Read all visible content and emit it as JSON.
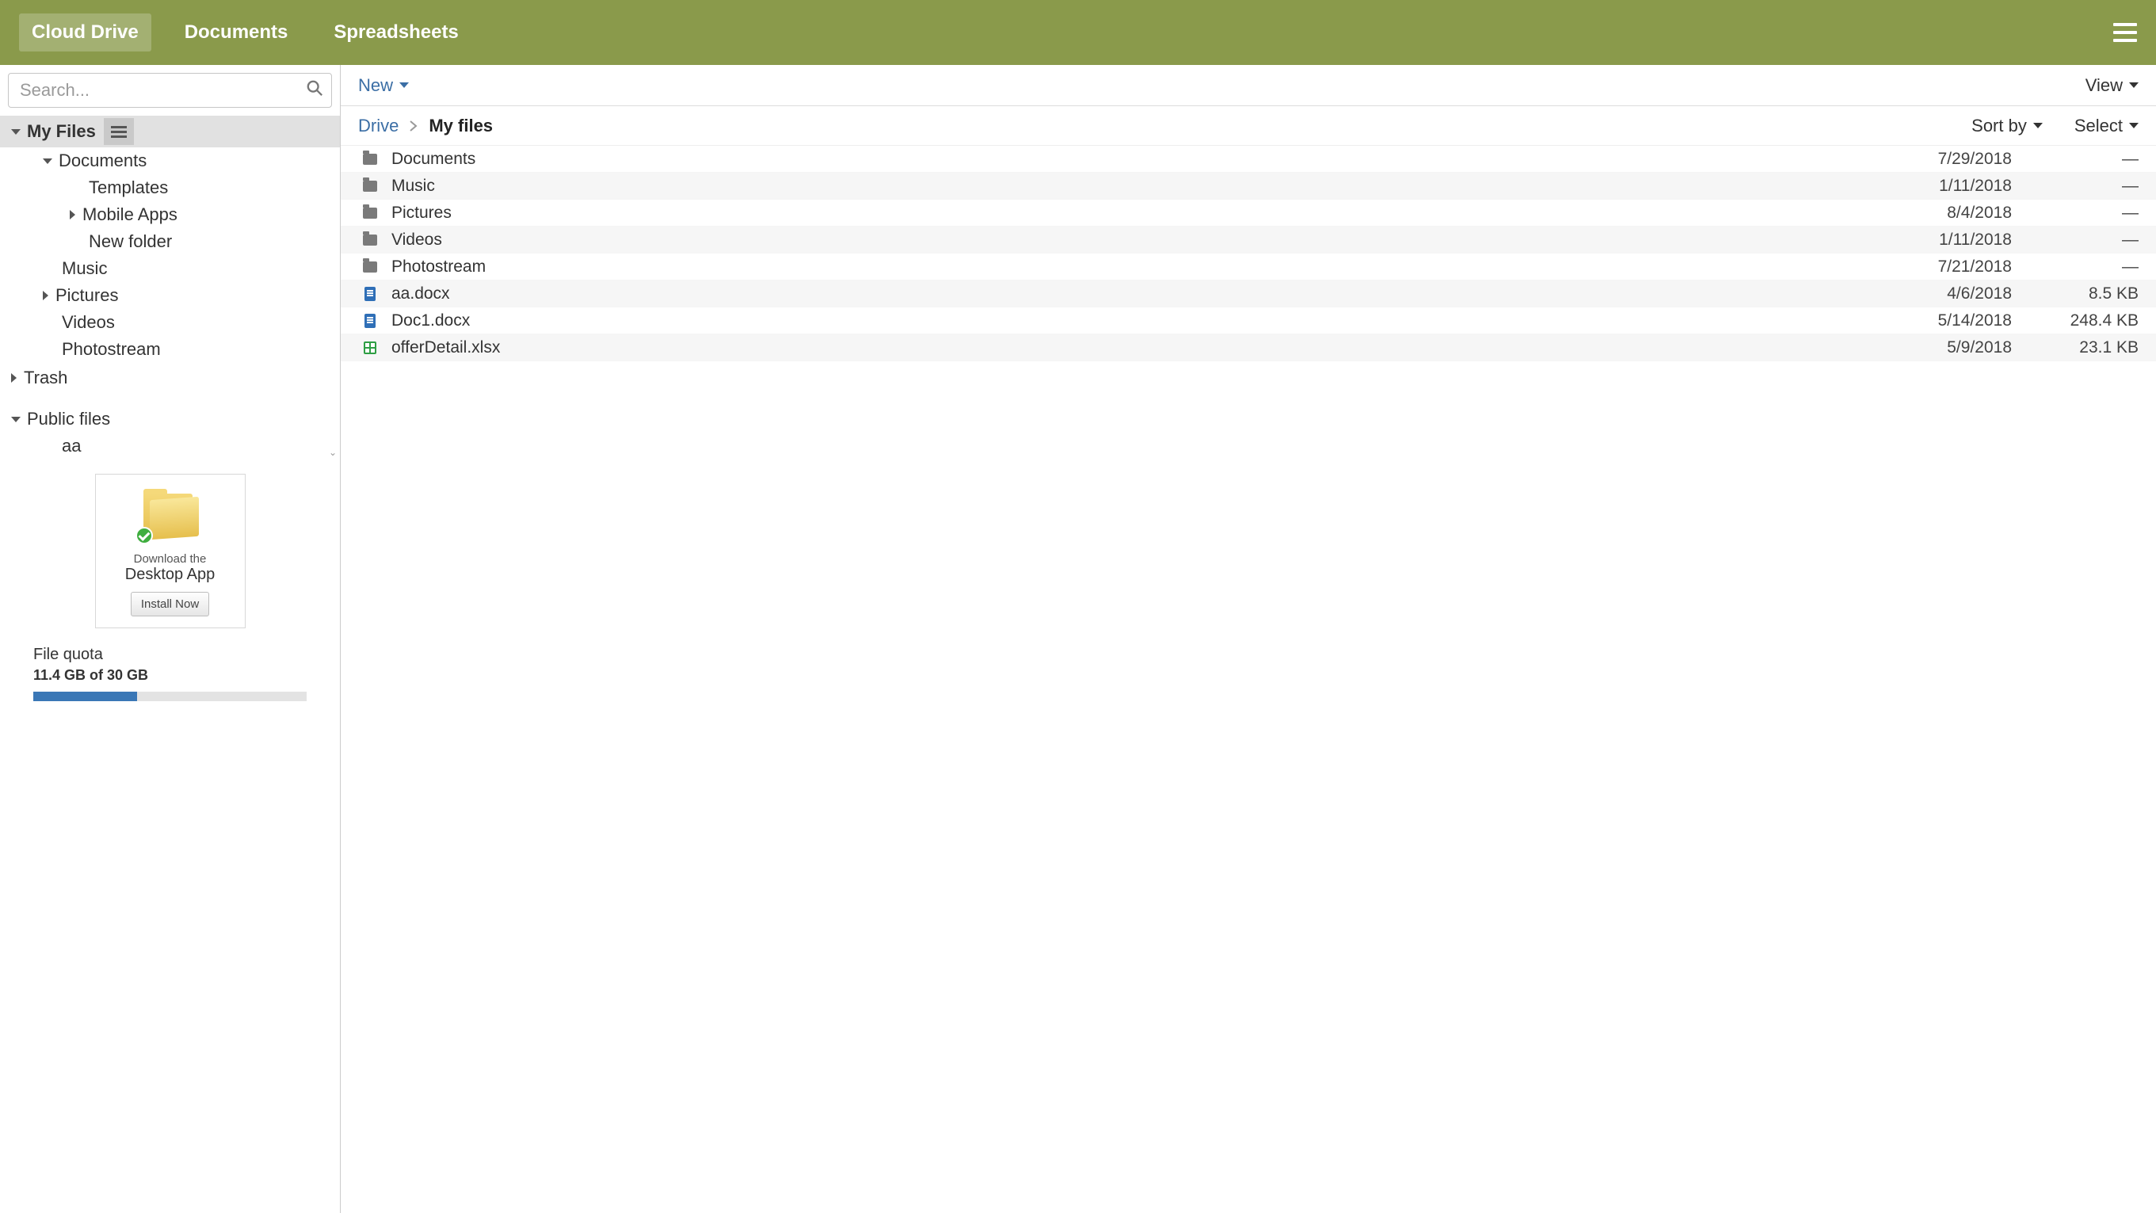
{
  "topbar": {
    "tabs": [
      {
        "label": "Cloud Drive",
        "active": true
      },
      {
        "label": "Documents",
        "active": false
      },
      {
        "label": "Spreadsheets",
        "active": false
      }
    ]
  },
  "search": {
    "placeholder": "Search..."
  },
  "tree": {
    "root": "My Files",
    "nodes": [
      {
        "label": "Documents",
        "level": 1,
        "caret": "down",
        "id": "documents"
      },
      {
        "label": "Templates",
        "level": 2,
        "caret": "none",
        "id": "templates"
      },
      {
        "label": "Mobile Apps",
        "level": 2,
        "caret": "right",
        "id": "mobile-apps"
      },
      {
        "label": "New folder",
        "level": 2,
        "caret": "none",
        "id": "new-folder"
      },
      {
        "label": "Music",
        "level": 1,
        "caret": "none",
        "id": "music"
      },
      {
        "label": "Pictures",
        "level": 1,
        "caret": "right",
        "id": "pictures"
      },
      {
        "label": "Videos",
        "level": 1,
        "caret": "none",
        "id": "videos"
      },
      {
        "label": "Photostream",
        "level": 1,
        "caret": "none",
        "id": "photostream"
      }
    ],
    "trash": "Trash",
    "public": "Public files",
    "public_children": [
      {
        "label": "aa",
        "id": "public-aa"
      }
    ]
  },
  "promo": {
    "line1": "Download the",
    "line2": "Desktop App",
    "button": "Install Now"
  },
  "quota": {
    "label": "File quota",
    "text": "11.4 GB of 30 GB",
    "percent": 38
  },
  "toolbar": {
    "new_label": "New",
    "view_label": "View"
  },
  "listbar": {
    "drive": "Drive",
    "current": "My files",
    "sort": "Sort by",
    "select": "Select"
  },
  "files": [
    {
      "type": "folder",
      "name": "Documents",
      "date": "7/29/2018",
      "size": "—"
    },
    {
      "type": "folder",
      "name": "Music",
      "date": "1/11/2018",
      "size": "—"
    },
    {
      "type": "folder",
      "name": "Pictures",
      "date": "8/4/2018",
      "size": "—"
    },
    {
      "type": "folder",
      "name": "Videos",
      "date": "1/11/2018",
      "size": "—"
    },
    {
      "type": "folder",
      "name": "Photostream",
      "date": "7/21/2018",
      "size": "—"
    },
    {
      "type": "doc",
      "name": "aa.docx",
      "date": "4/6/2018",
      "size": "8.5 KB"
    },
    {
      "type": "doc",
      "name": "Doc1.docx",
      "date": "5/14/2018",
      "size": "248.4 KB"
    },
    {
      "type": "sheet",
      "name": "offerDetail.xlsx",
      "date": "5/9/2018",
      "size": "23.1 KB"
    }
  ]
}
